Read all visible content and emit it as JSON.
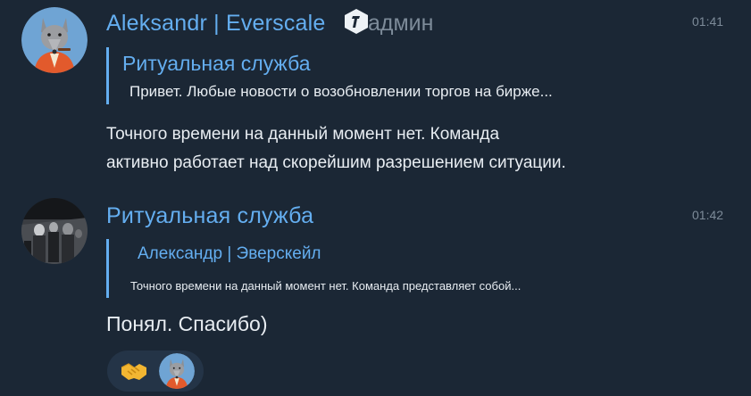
{
  "colors": {
    "background": "#1b2735",
    "accent": "#64aef0",
    "text": "#e8edf2",
    "muted": "#7d8b99",
    "reaction_bg": "#243447"
  },
  "messages": [
    {
      "author": "Aleksandr | Everscale",
      "role": "админ",
      "badge_icon": "admin-badge-icon",
      "avatar_icon": "wolf-avatar-icon",
      "time": "01:41",
      "reply": {
        "author": "Ритуальная служба",
        "text": "Привет. Любые новости о возобновлении торгов на бирже..."
      },
      "text_lines": [
        "Точного времени на данный момент нет. Команда",
        "активно работает над скорейшим разрешением ситуации."
      ]
    },
    {
      "author": "Ритуальная служба",
      "avatar_icon": "crowd-photo-avatar-icon",
      "time": "01:42",
      "reply": {
        "author": "Александр | Эверскейл",
        "text": "Точного времени на данный момент нет. Команда представляет собой..."
      },
      "text": "Понял. Спасибо)",
      "reaction": {
        "emoji_icon": "handshake-icon",
        "reactor_avatar_icon": "wolf-avatar-icon"
      }
    }
  ]
}
